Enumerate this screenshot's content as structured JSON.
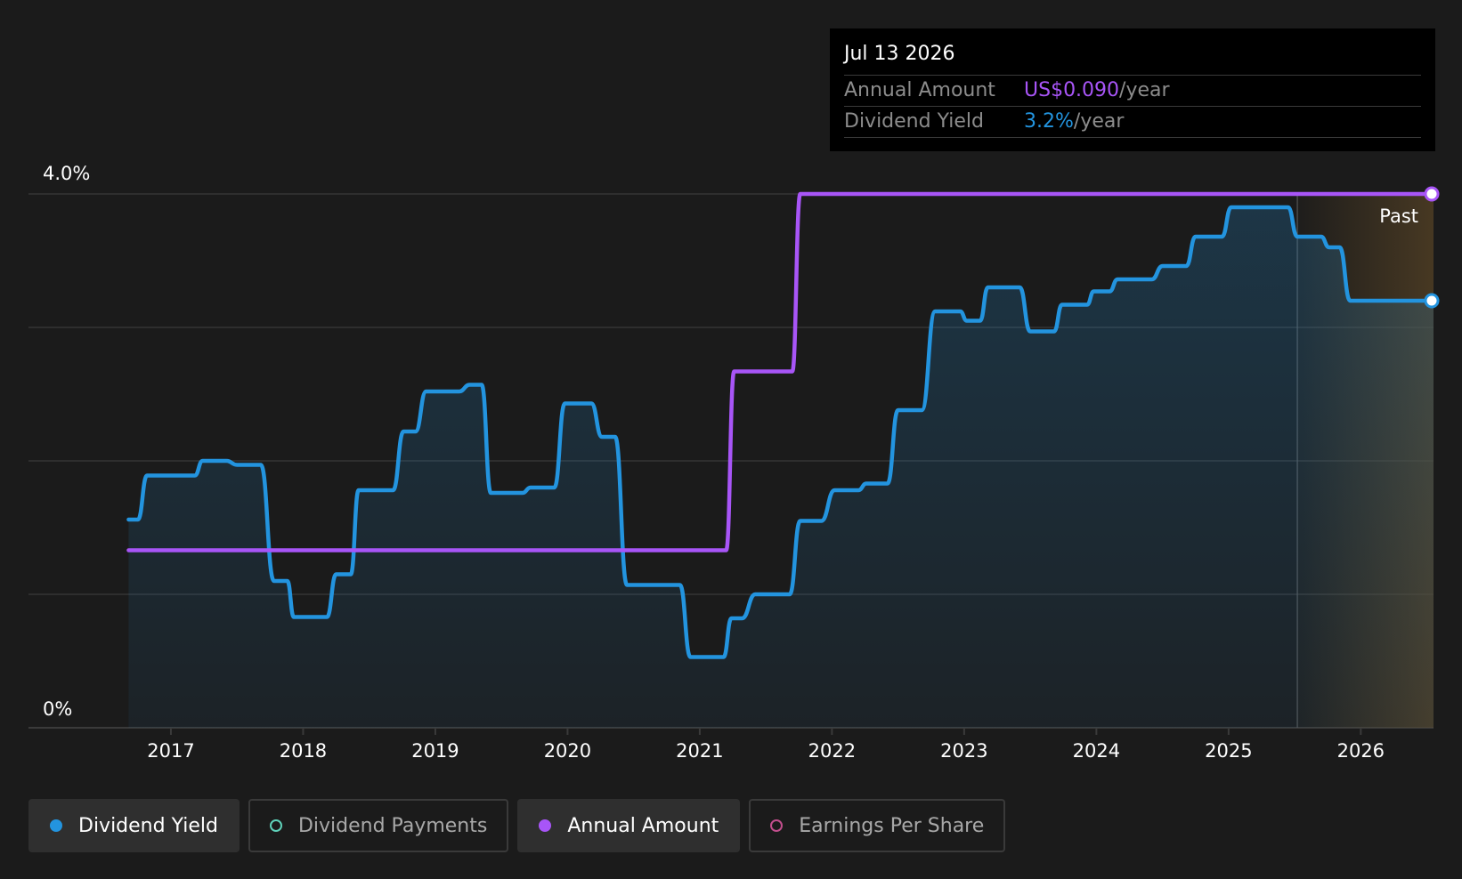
{
  "colors": {
    "yield": "#2394df",
    "annual": "#a855f7",
    "payments": "#5fd1b9",
    "eps": "#c14e8c",
    "background": "#1b1b1b",
    "grid": "#3a3a3a",
    "axis_text": "#ffffff",
    "forecast_tint": "#5a4526"
  },
  "tooltip": {
    "date": "Jul 13 2026",
    "rows": [
      {
        "label": "Annual Amount",
        "value": "US$0.090",
        "suffix": "/year",
        "color": "#a855f7"
      },
      {
        "label": "Dividend Yield",
        "value": "3.2%",
        "suffix": "/year",
        "color": "#2394df"
      }
    ]
  },
  "legend": [
    {
      "label": "Dividend Yield",
      "active": true,
      "color": "#2394df",
      "filled": true
    },
    {
      "label": "Dividend Payments",
      "active": false,
      "color": "#5fd1b9",
      "filled": false
    },
    {
      "label": "Annual Amount",
      "active": true,
      "color": "#a855f7",
      "filled": true
    },
    {
      "label": "Earnings Per Share",
      "active": false,
      "color": "#c14e8c",
      "filled": false
    }
  ],
  "chart_data": {
    "type": "line",
    "y_tick_labels": [
      "4.0%",
      "0%"
    ],
    "ylim": [
      0,
      4.0
    ],
    "xlim": [
      2016.32,
      2026.55
    ],
    "x_tick_labels": [
      "2017",
      "2018",
      "2019",
      "2020",
      "2021",
      "2022",
      "2023",
      "2024",
      "2025",
      "2026"
    ],
    "x_ticks": [
      2017,
      2018,
      2019,
      2020,
      2021,
      2022,
      2023,
      2024,
      2025,
      2026
    ],
    "grid": true,
    "past_label": "Past",
    "forecast_start": 2025.52,
    "series": [
      {
        "name": "Dividend Yield",
        "unit": "%",
        "area": true,
        "points": [
          [
            2016.68,
            1.56
          ],
          [
            2016.75,
            1.56
          ],
          [
            2016.82,
            1.89
          ],
          [
            2016.98,
            1.89
          ],
          [
            2017.18,
            1.89
          ],
          [
            2017.24,
            2.0
          ],
          [
            2017.42,
            2.0
          ],
          [
            2017.5,
            1.97
          ],
          [
            2017.68,
            1.97
          ],
          [
            2017.78,
            1.1
          ],
          [
            2017.88,
            1.1
          ],
          [
            2017.93,
            0.83
          ],
          [
            2018.18,
            0.83
          ],
          [
            2018.25,
            1.15
          ],
          [
            2018.36,
            1.15
          ],
          [
            2018.42,
            1.78
          ],
          [
            2018.68,
            1.78
          ],
          [
            2018.76,
            2.22
          ],
          [
            2018.85,
            2.22
          ],
          [
            2018.93,
            2.52
          ],
          [
            2019.18,
            2.52
          ],
          [
            2019.26,
            2.57
          ],
          [
            2019.35,
            2.57
          ],
          [
            2019.42,
            1.76
          ],
          [
            2019.66,
            1.76
          ],
          [
            2019.72,
            1.8
          ],
          [
            2019.9,
            1.8
          ],
          [
            2019.98,
            2.43
          ],
          [
            2020.18,
            2.43
          ],
          [
            2020.26,
            2.18
          ],
          [
            2020.36,
            2.18
          ],
          [
            2020.45,
            1.07
          ],
          [
            2020.85,
            1.07
          ],
          [
            2020.93,
            0.53
          ],
          [
            2021.18,
            0.53
          ],
          [
            2021.24,
            0.82
          ],
          [
            2021.32,
            0.82
          ],
          [
            2021.42,
            1.0
          ],
          [
            2021.68,
            1.0
          ],
          [
            2021.76,
            1.55
          ],
          [
            2021.92,
            1.55
          ],
          [
            2022.02,
            1.78
          ],
          [
            2022.2,
            1.78
          ],
          [
            2022.26,
            1.83
          ],
          [
            2022.42,
            1.83
          ],
          [
            2022.5,
            2.38
          ],
          [
            2022.68,
            2.38
          ],
          [
            2022.78,
            3.12
          ],
          [
            2022.97,
            3.12
          ],
          [
            2023.02,
            3.05
          ],
          [
            2023.12,
            3.05
          ],
          [
            2023.18,
            3.3
          ],
          [
            2023.42,
            3.3
          ],
          [
            2023.5,
            2.97
          ],
          [
            2023.68,
            2.97
          ],
          [
            2023.74,
            3.17
          ],
          [
            2023.93,
            3.17
          ],
          [
            2023.98,
            3.27
          ],
          [
            2024.1,
            3.27
          ],
          [
            2024.16,
            3.36
          ],
          [
            2024.42,
            3.36
          ],
          [
            2024.5,
            3.46
          ],
          [
            2024.68,
            3.46
          ],
          [
            2024.75,
            3.68
          ],
          [
            2024.95,
            3.68
          ],
          [
            2025.02,
            3.9
          ],
          [
            2025.45,
            3.9
          ],
          [
            2025.52,
            3.68
          ],
          [
            2025.7,
            3.68
          ],
          [
            2025.76,
            3.6
          ],
          [
            2025.84,
            3.6
          ],
          [
            2025.92,
            3.2
          ],
          [
            2026.55,
            3.2
          ]
        ]
      },
      {
        "name": "Annual Amount",
        "unit": "US$",
        "area": false,
        "points": [
          [
            2016.68,
            1.33
          ],
          [
            2020.2,
            1.33
          ],
          [
            2021.2,
            1.33
          ],
          [
            2021.26,
            2.67
          ],
          [
            2021.7,
            2.67
          ],
          [
            2021.76,
            4.0
          ],
          [
            2026.55,
            4.0
          ]
        ]
      }
    ]
  }
}
